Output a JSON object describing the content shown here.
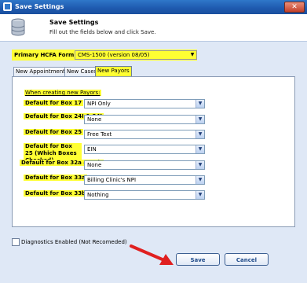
{
  "window": {
    "title": "Save Settings",
    "close_glyph": "✕"
  },
  "header": {
    "title": "Save Settings",
    "subtitle": "Fill out the fields below and click Save."
  },
  "primary_form": {
    "label": "Primary HCFA Form",
    "value": "CMS-1500 (version 08/05)"
  },
  "tabs": [
    {
      "label": "New Appointments",
      "active": false
    },
    {
      "label": "New Cases",
      "active": false
    },
    {
      "label": "New Payors",
      "active": true
    }
  ],
  "payors": {
    "intro": "When creating new Payors:",
    "rows": [
      {
        "label": "Default for Box 17",
        "value": "NPI Only"
      },
      {
        "label": "Default for Box 24I & 24J",
        "value": "None"
      },
      {
        "label": "Default for Box 25",
        "value": "Free Text"
      },
      {
        "label": "Default for Box 25 (Which Boxes Checked)",
        "value": "EIN"
      },
      {
        "label": "Default for Box 32a & 32b",
        "value": "None"
      },
      {
        "label": "Default for Box 33a",
        "value": "Billing Clinic's NPI"
      },
      {
        "label": "Default for Box 33b",
        "value": "Nothing"
      }
    ]
  },
  "diagnostics": {
    "label": "Diagnostics Enabled (Not Recomeded)",
    "checked": false
  },
  "buttons": {
    "save": "Save",
    "cancel": "Cancel"
  },
  "colors": {
    "highlight": "#ffff33",
    "annotation_arrow": "#e02020"
  },
  "icons": {
    "select_arrow": "▼"
  }
}
